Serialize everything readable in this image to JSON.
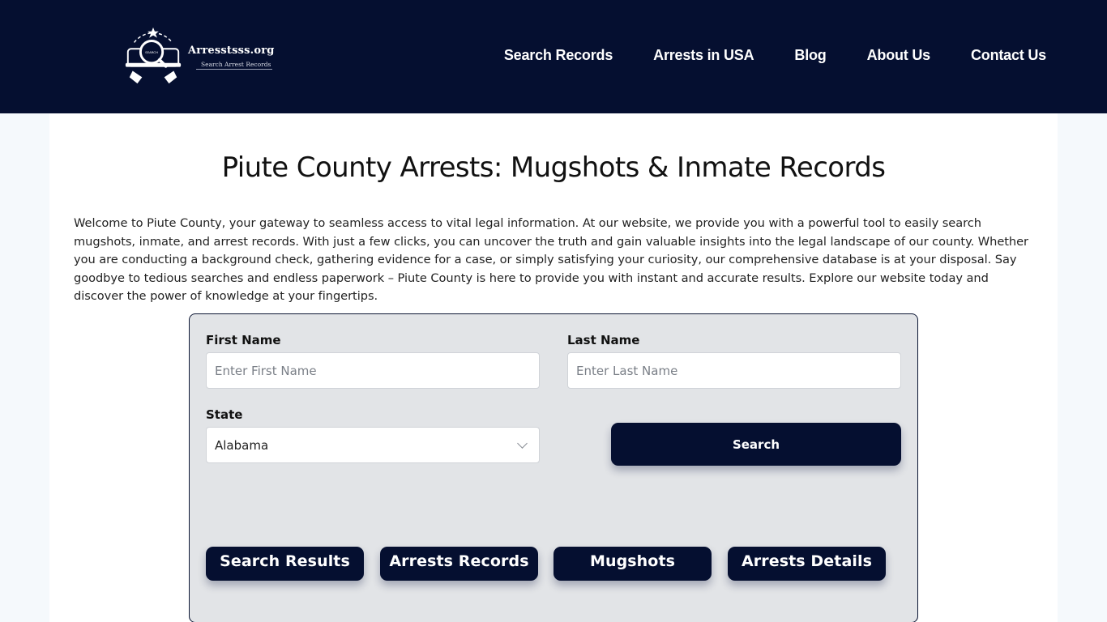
{
  "header": {
    "logo": {
      "name": "Arresstsss.org",
      "tagline": "Search Arrest Records",
      "emblem_icon": "search-magnifier-badge-icon",
      "emblem_label": "SEARCH"
    },
    "nav": [
      {
        "label": "Search Records"
      },
      {
        "label": "Arrests in USA"
      },
      {
        "label": "Blog"
      },
      {
        "label": "About Us"
      },
      {
        "label": "Contact Us"
      }
    ]
  },
  "main": {
    "title": "Piute County Arrests: Mugshots & Inmate Records",
    "intro": "Welcome to Piute County, your gateway to seamless access to vital legal information. At our website, we provide you with a powerful tool to easily search mugshots, inmate, and arrest records. With just a few clicks, you can uncover the truth and gain valuable insights into the legal landscape of our county. Whether you are conducting a background check, gathering evidence for a case, or simply satisfying your curiosity, our comprehensive database is at your disposal. Say goodbye to tedious searches and endless paperwork – Piute County is here to provide you with instant and accurate results. Explore our website today and discover the power of knowledge at your fingertips."
  },
  "form": {
    "first_name": {
      "label": "First Name",
      "placeholder": "Enter First Name",
      "value": ""
    },
    "last_name": {
      "label": "Last Name",
      "placeholder": "Enter Last Name",
      "value": ""
    },
    "state": {
      "label": "State",
      "selected": "Alabama"
    },
    "search_button": "Search",
    "links": [
      {
        "label": "Search Results"
      },
      {
        "label": "Arrests Records"
      },
      {
        "label": "Mugshots"
      },
      {
        "label": "Arrests Details"
      }
    ]
  },
  "colors": {
    "header_bg": "#050f30",
    "button_bg": "#050f30",
    "form_bg": "#e2e4e7",
    "page_bg": "#f5f9fc"
  }
}
